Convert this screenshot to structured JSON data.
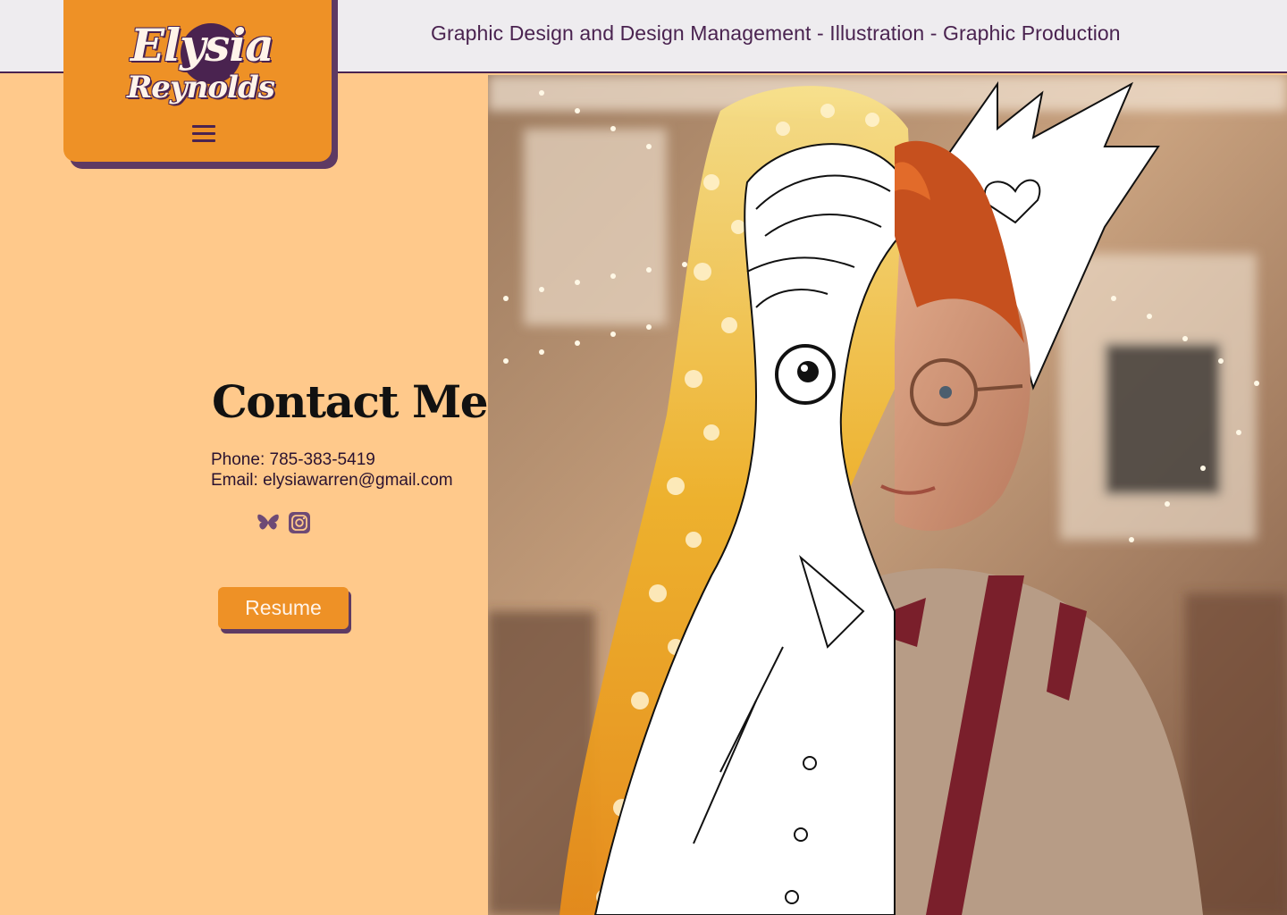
{
  "header": {
    "tagline": "Graphic Design and Design Management - Illustration - Graphic Production"
  },
  "logo": {
    "line1": "Elysia",
    "line2": "Reynolds"
  },
  "contact": {
    "title": "Contact Me",
    "phone": "Phone: 785-383-5419",
    "email": "Email: elysiawarren@gmail.com"
  },
  "social": {
    "icons": [
      "butterfly-icon",
      "instagram-icon"
    ]
  },
  "resume": {
    "label": "Resume"
  },
  "colors": {
    "page_bg": "#FFC98B",
    "accent": "#EE9126",
    "purple": "#4A2350",
    "topbar": "#EEECEF"
  }
}
